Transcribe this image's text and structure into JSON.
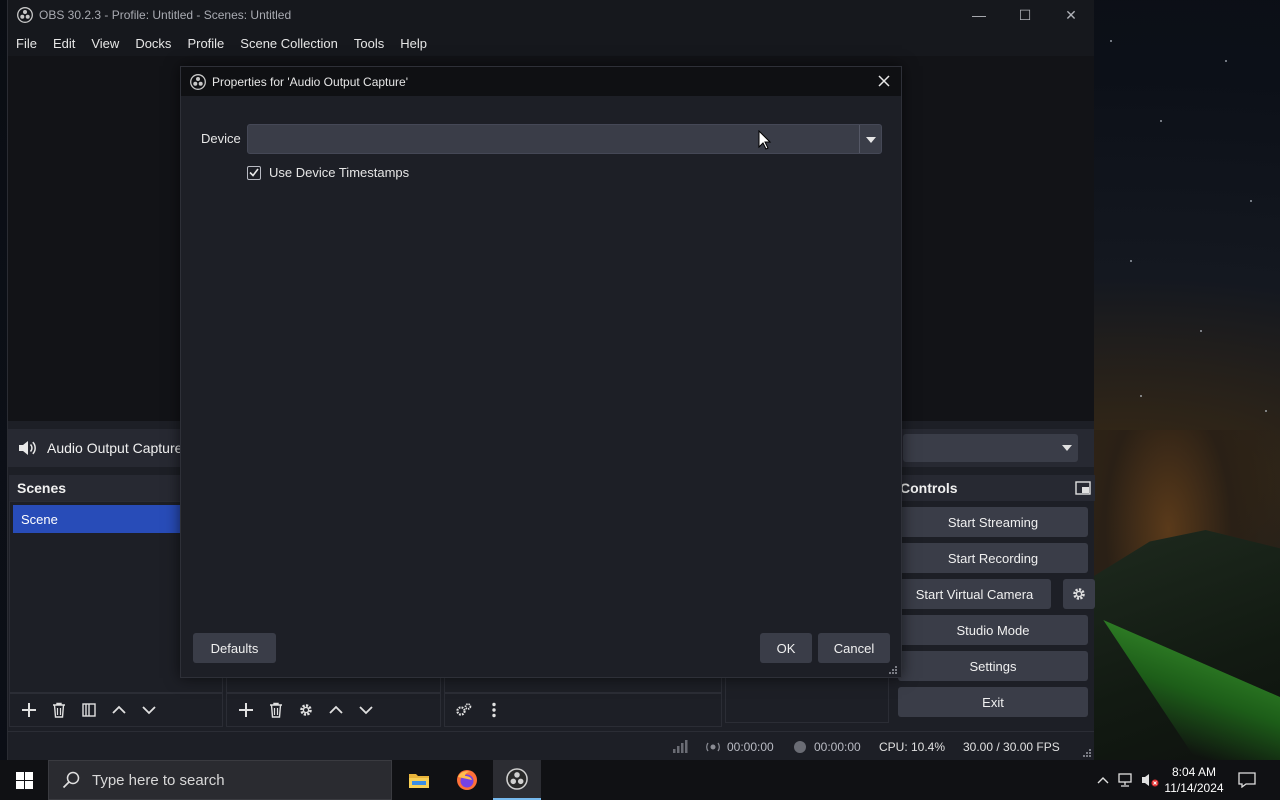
{
  "window": {
    "title": "OBS 30.2.3 - Profile: Untitled - Scenes: Untitled",
    "controls": {
      "minimize": "—",
      "maximize": "☐",
      "close": "✕"
    }
  },
  "menu": [
    "File",
    "Edit",
    "View",
    "Docks",
    "Profile",
    "Scene Collection",
    "Tools",
    "Help"
  ],
  "source_bar": {
    "label": "Audio Output Capture",
    "icon": "speaker-icon"
  },
  "scenes": {
    "title": "Scenes",
    "items": [
      "Scene"
    ]
  },
  "controls": {
    "title": "Controls",
    "start_streaming": "Start Streaming",
    "start_recording": "Start Recording",
    "start_virtual_camera": "Start Virtual Camera",
    "studio_mode": "Studio Mode",
    "settings": "Settings",
    "exit": "Exit"
  },
  "status": {
    "stream_time": "00:00:00",
    "record_time": "00:00:00",
    "cpu": "CPU: 10.4%",
    "fps": "30.00 / 30.00 FPS"
  },
  "dialog": {
    "title": "Properties for 'Audio Output Capture'",
    "device_label": "Device",
    "device_value": "",
    "use_device_timestamps": "Use Device Timestamps",
    "use_device_timestamps_checked": true,
    "defaults": "Defaults",
    "ok": "OK",
    "cancel": "Cancel"
  },
  "taskbar": {
    "search_placeholder": "Type here to search",
    "time": "8:04 AM",
    "date": "11/14/2024"
  },
  "colors": {
    "accent": "#284cb8",
    "button": "#3a3d48",
    "panel": "#1d1f26",
    "taskbar_active": "#76b9ed"
  }
}
